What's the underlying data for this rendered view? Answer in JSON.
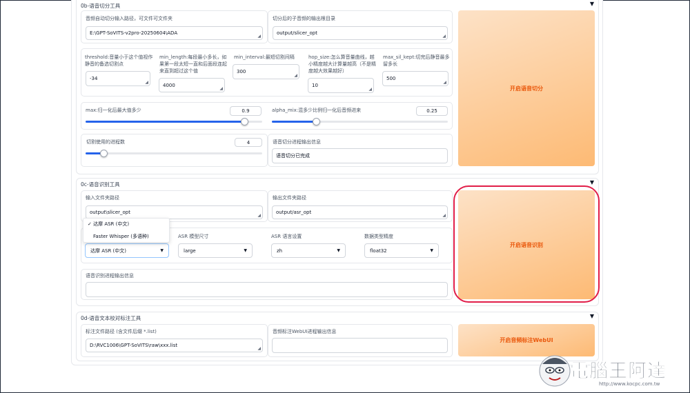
{
  "slicer": {
    "title": "0b-语音切分工具",
    "input_label": "音频自动切分输入路径，可文件可文件夹",
    "input_value": "E:\\GPT-SoVITS-v2pro-20250604\\ADA",
    "output_label": "切分后的子音频的输出根目录",
    "output_value": "output/slicer_opt",
    "params": [
      {
        "label": "threshold:音量小于这个值视作静音的备选切割点",
        "value": "-34"
      },
      {
        "label": "min_length:每段最小多长，如果第一段太短一直和后面段连起来直到超过这个值",
        "value": "4000"
      },
      {
        "label": "min_interval:最短切割间隔",
        "value": "300"
      },
      {
        "label": "hop_size:怎么算音量曲线，越小精度越大计算量越高（不是精度越大效果越好）",
        "value": "10"
      },
      {
        "label": "max_sil_kept:切完后静音最多留多长",
        "value": "500"
      }
    ],
    "max_label": "max:归一化后最大值多少",
    "max_value": "0.9",
    "max_fraction": 0.9,
    "alpha_label": "alpha_mix:混多少比例归一化后音频进来",
    "alpha_value": "0.25",
    "alpha_fraction": 0.25,
    "procs_label": "切割使用的进程数",
    "procs_value": "4",
    "procs_fraction": 0.1,
    "info_label": "语音切分进程输出信息",
    "info_value": "语音切分已完成",
    "run_button": "开启语音切分"
  },
  "asr": {
    "title": "0c-语音识别工具",
    "input_label": "输入文件夹路径",
    "input_value": "output\\slicer_opt",
    "output_label": "输出文件夹路径",
    "output_value": "output/asr_opt",
    "dropdown_options": [
      "✓ 达摩 ASR (中文)",
      "Faster Whisper (多语种)"
    ],
    "model_value": "达摩 ASR (中文)",
    "size_label": "ASR 模型尺寸",
    "size_value": "large",
    "lang_label": "ASR 语言设置",
    "lang_value": "zh",
    "precision_label": "数据类型精度",
    "precision_value": "float32",
    "info_label": "语音识别进程输出信息",
    "info_value": "",
    "run_button": "开启语音识别"
  },
  "label": {
    "title": "0d-语音文本校对标注工具",
    "path_label": "标注文件路径 (含文件后缀 *.list)",
    "path_value": "D:\\RVC1006\\GPT-SoVITS\\raw\\xxx.list",
    "info_label": "音频标注WebUI进程输出信息",
    "info_value": "",
    "run_button": "开启音频标注WebUI"
  },
  "caret_glyph": "▼",
  "grip_glyph": "◢",
  "select_glyph": "▼",
  "watermark": {
    "brand": "電腦王阿達",
    "url": "http://www.kocpc.com.tw"
  },
  "colors": {
    "accent_orange": "#ea580c",
    "slider_blue": "#2563eb",
    "highlight_red": "#e11d48"
  }
}
